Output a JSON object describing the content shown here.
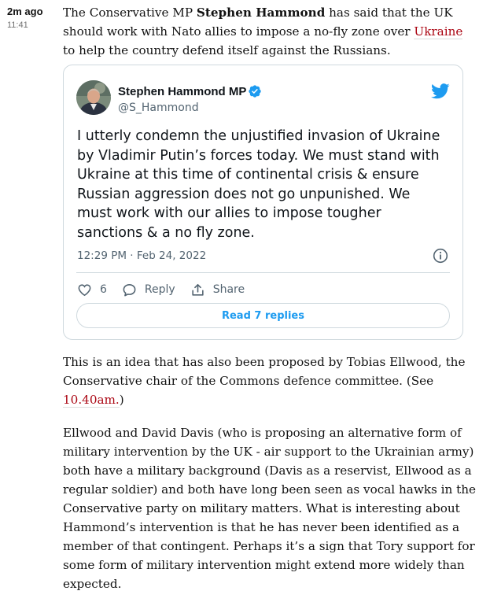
{
  "post": {
    "relative_time": "2m ago",
    "clock_time": "11:41"
  },
  "intro": {
    "part1": "The Conservative MP ",
    "name": "Stephen Hammond",
    "part2": " has said that the UK",
    "line2": "should work with Nato allies to impose a no-fly zone over ",
    "link": "Ukraine",
    "line3": "to help the country defend itself against the Russians."
  },
  "tweet": {
    "author_name": "Stephen Hammond MP",
    "author_handle": "@S_Hammond",
    "text_lines": [
      "I utterly condemn the unjustified invasion of Ukraine",
      "by Vladimir Putin’s forces today. We must stand with",
      "Ukraine at this time of continental crisis & ensure",
      "Russian aggression does not go unpunished. We",
      "must work with our allies to impose tougher",
      "sanctions & a no fly zone."
    ],
    "date": "12:29 PM · Feb 24, 2022",
    "like_count": "6",
    "reply_label": "Reply",
    "share_label": "Share",
    "read_replies_label": "Read 7 replies",
    "icons": {
      "verified": "verified-badge-icon",
      "brand": "twitter-bird-icon",
      "info": "info-icon",
      "like": "heart-icon",
      "reply": "speech-bubble-icon",
      "share": "share-upload-icon"
    },
    "colors": {
      "twitter_blue": "#1d9bf0",
      "muted": "#536471",
      "border": "#cfd9de"
    }
  },
  "para2": {
    "lines": [
      "This is an idea that has also been proposed by Tobias Ellwood, the",
      "Conservative chair of the Commons defence committee. (See"
    ],
    "link": "10.40am.",
    "after_link": ")"
  },
  "para3": {
    "lines": [
      "Ellwood and David Davis (who is proposing an alternative form of",
      "military intervention by the UK - air support to the Ukrainian army)",
      "both have a military background (Davis as a reservist, Ellwood as a",
      "regular soldier) and both have long been seen as vocal hawks in the",
      "Conservative party on military matters. What is interesting about",
      "Hammond’s intervention is that he has never been identified as a",
      "member of that contingent. Perhaps it’s a sign that Tory support for",
      "some form of military intervention might extend more widely than",
      "expected."
    ]
  },
  "colors": {
    "link": "#ab0613",
    "text": "#121212",
    "meta_muted": "#707070"
  }
}
